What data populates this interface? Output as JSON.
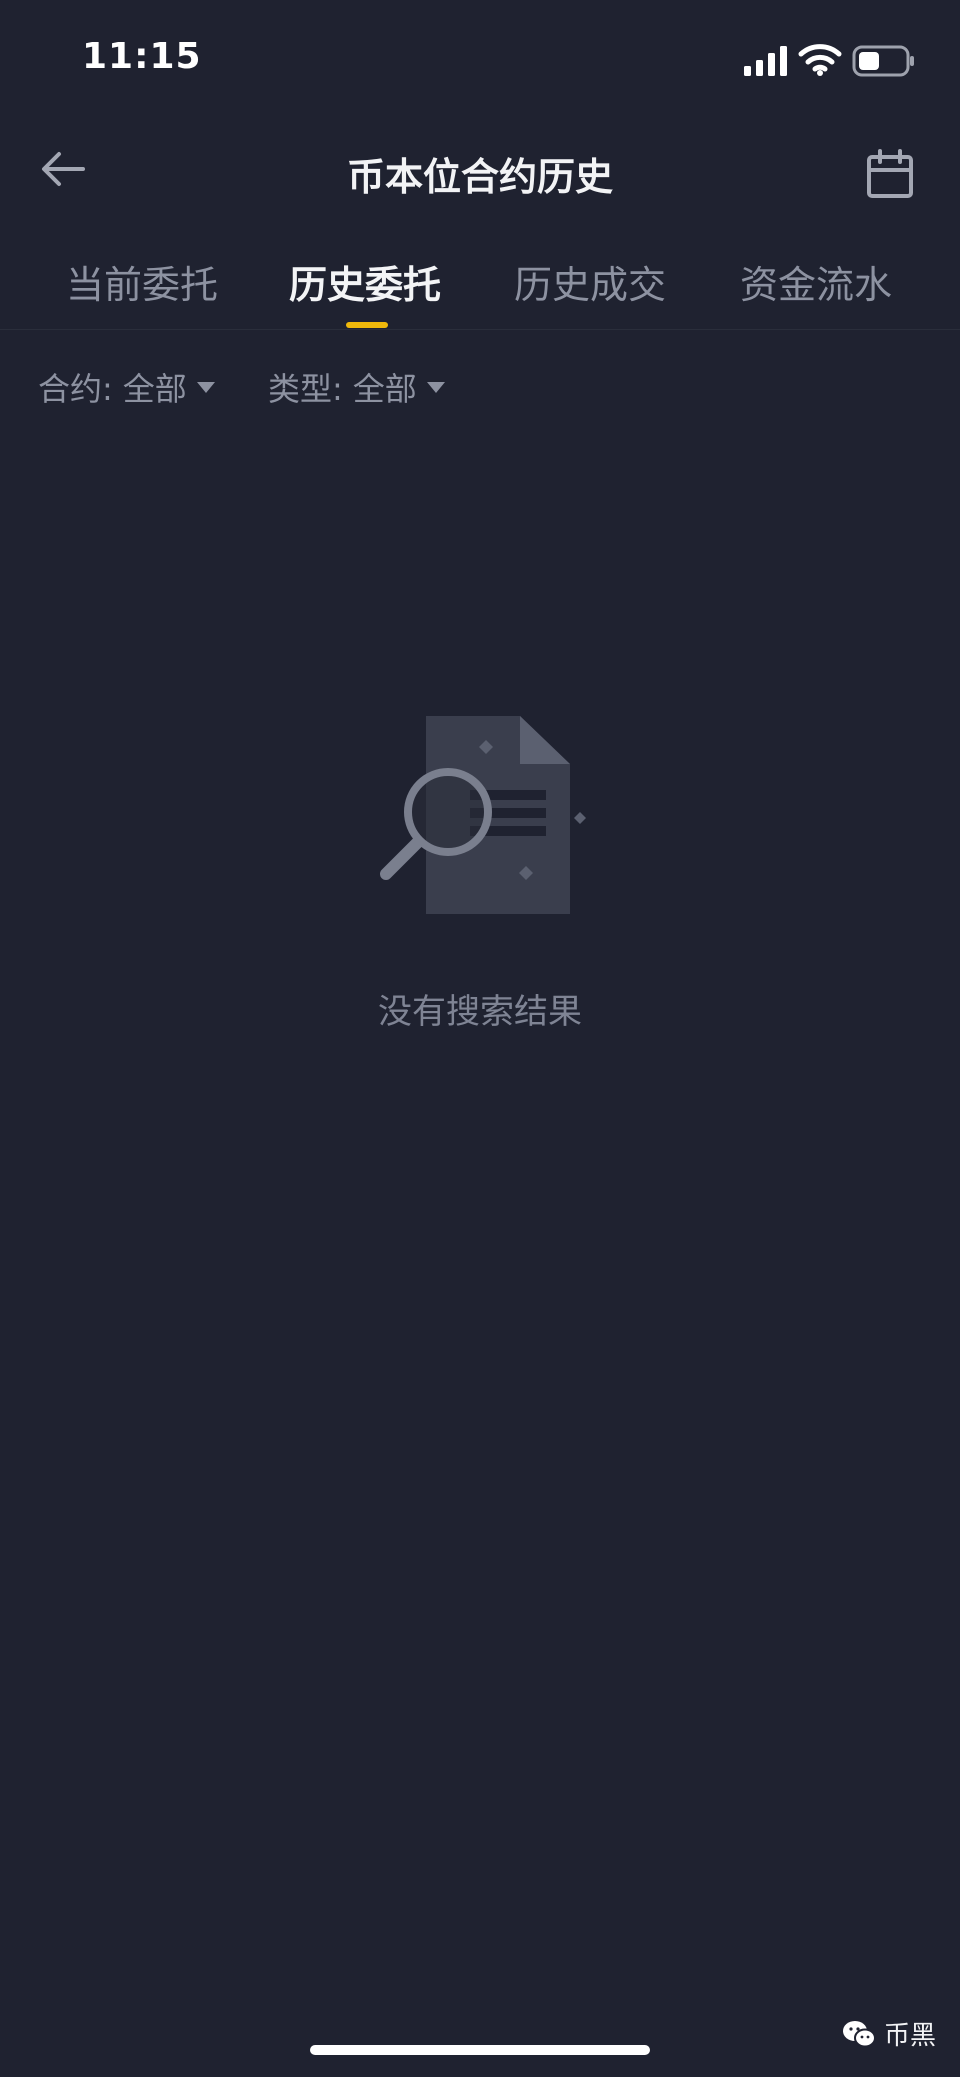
{
  "status_bar": {
    "time": "11:15",
    "icons": [
      "signal-icon",
      "wifi-icon",
      "battery-icon"
    ]
  },
  "header": {
    "title": "币本位合约历史",
    "back_icon": "back-arrow-icon",
    "calendar_icon": "calendar-icon"
  },
  "tabs": [
    {
      "label": "当前委托",
      "active": false
    },
    {
      "label": "历史委托",
      "active": true
    },
    {
      "label": "历史成交",
      "active": false
    },
    {
      "label": "资金流水",
      "active": false
    }
  ],
  "filters": {
    "contract": {
      "label": "合约:",
      "value": "全部"
    },
    "type": {
      "label": "类型:",
      "value": "全部"
    }
  },
  "empty_state": {
    "message": "没有搜索结果",
    "icon": "document-search-icon"
  },
  "watermark": {
    "text": "币黑",
    "icon": "wechat-icon"
  },
  "colors": {
    "background": "#1f2230",
    "accent": "#f0b90b",
    "muted_text": "#8d92a1"
  }
}
